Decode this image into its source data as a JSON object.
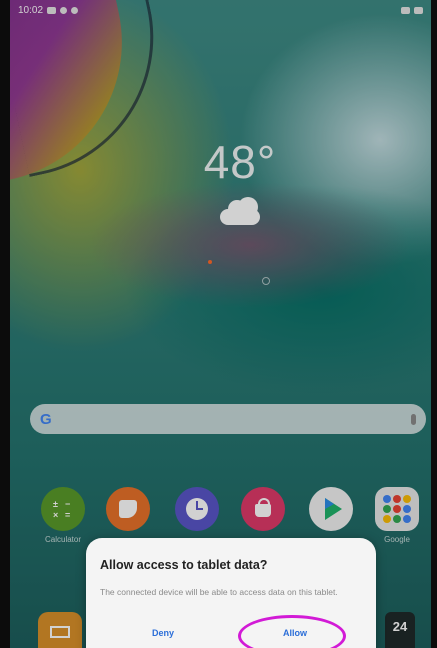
{
  "status_bar": {
    "time": "10:02"
  },
  "weather": {
    "temperature": "48°",
    "icon": "cloud-icon"
  },
  "search": {
    "logo": "G",
    "icon": "mic-icon"
  },
  "apps": [
    {
      "label": "Calculator",
      "icon": "calculator-icon",
      "color": "#5a9a2a"
    },
    {
      "label": "",
      "icon": "notes-icon",
      "color": "#e8722a"
    },
    {
      "label": "",
      "icon": "clock-icon",
      "color": "#5a56c8"
    },
    {
      "label": "",
      "icon": "store-icon",
      "color": "#e03a6a"
    },
    {
      "label": "",
      "icon": "play-store-icon",
      "color": "#ffffff"
    },
    {
      "label": "Google",
      "icon": "google-folder-icon",
      "color": "#e8e8e8"
    }
  ],
  "dialog": {
    "title": "Allow access to tablet data?",
    "message": "The connected device will be able to access data on this tablet.",
    "deny_label": "Deny",
    "allow_label": "Allow"
  },
  "dock": {
    "calendar_day": "24"
  },
  "colors": {
    "accent": "#2b6ed8",
    "highlight": "#d21ad6"
  }
}
